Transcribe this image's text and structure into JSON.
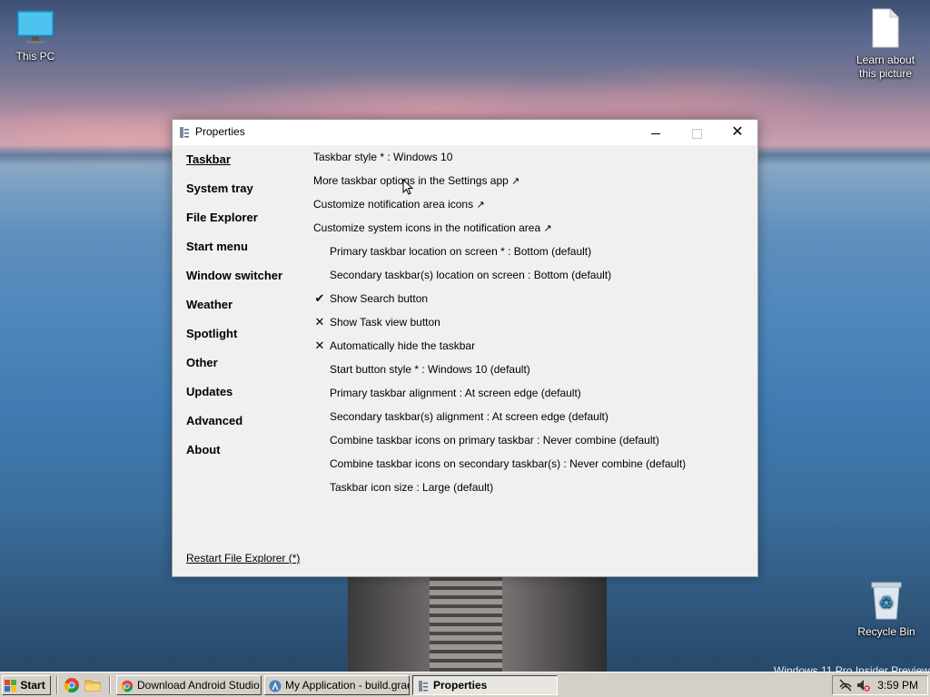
{
  "desktop": {
    "icons": [
      {
        "label": "This PC"
      },
      {
        "label": "Learn about this picture"
      },
      {
        "label": "Recycle Bin"
      }
    ],
    "watermark": "Windows 11 Pro Insider Preview"
  },
  "window": {
    "title": "Properties",
    "sidebar": [
      {
        "label": "Taskbar",
        "active": true
      },
      {
        "label": "System tray"
      },
      {
        "label": "File Explorer"
      },
      {
        "label": "Start menu"
      },
      {
        "label": "Window switcher"
      },
      {
        "label": "Weather"
      },
      {
        "label": "Spotlight"
      },
      {
        "label": "Other"
      },
      {
        "label": "Updates"
      },
      {
        "label": "Advanced"
      },
      {
        "label": "About"
      }
    ],
    "options": {
      "taskbar_style": "Taskbar style * : Windows 10",
      "more_options": "More taskbar options in the Settings app",
      "customize_notification": "Customize notification area icons",
      "customize_system_icons": "Customize system icons in the notification area",
      "primary_location": "Primary taskbar location on screen * : Bottom (default)",
      "secondary_location": "Secondary taskbar(s) location on screen : Bottom (default)",
      "show_search": "Show Search button",
      "show_task_view": "Show Task view button",
      "auto_hide": "Automatically hide the taskbar",
      "start_button_style": "Start button style * : Windows 10 (default)",
      "primary_alignment": "Primary taskbar alignment : At screen edge (default)",
      "secondary_alignment": "Secondary taskbar(s) alignment : At screen edge (default)",
      "combine_primary": "Combine taskbar icons on primary taskbar : Never combine (default)",
      "combine_secondary": "Combine taskbar icons on secondary taskbar(s) : Never combine (default)",
      "icon_size": "Taskbar icon size : Large (default)",
      "external_arrow": "↗",
      "check_mark": "✔",
      "cross_mark": "✕"
    },
    "restart_link": "Restart File Explorer (*)"
  },
  "taskbar": {
    "start_label": "Start",
    "tasks": [
      {
        "label": "Download Android Studio..."
      },
      {
        "label": "My Application - build.grad..."
      },
      {
        "label": "Properties"
      }
    ],
    "clock": "3:59 PM"
  },
  "colors": {
    "window_bg": "#f0f0f0",
    "taskbar_bg": "#d4d0c8"
  }
}
